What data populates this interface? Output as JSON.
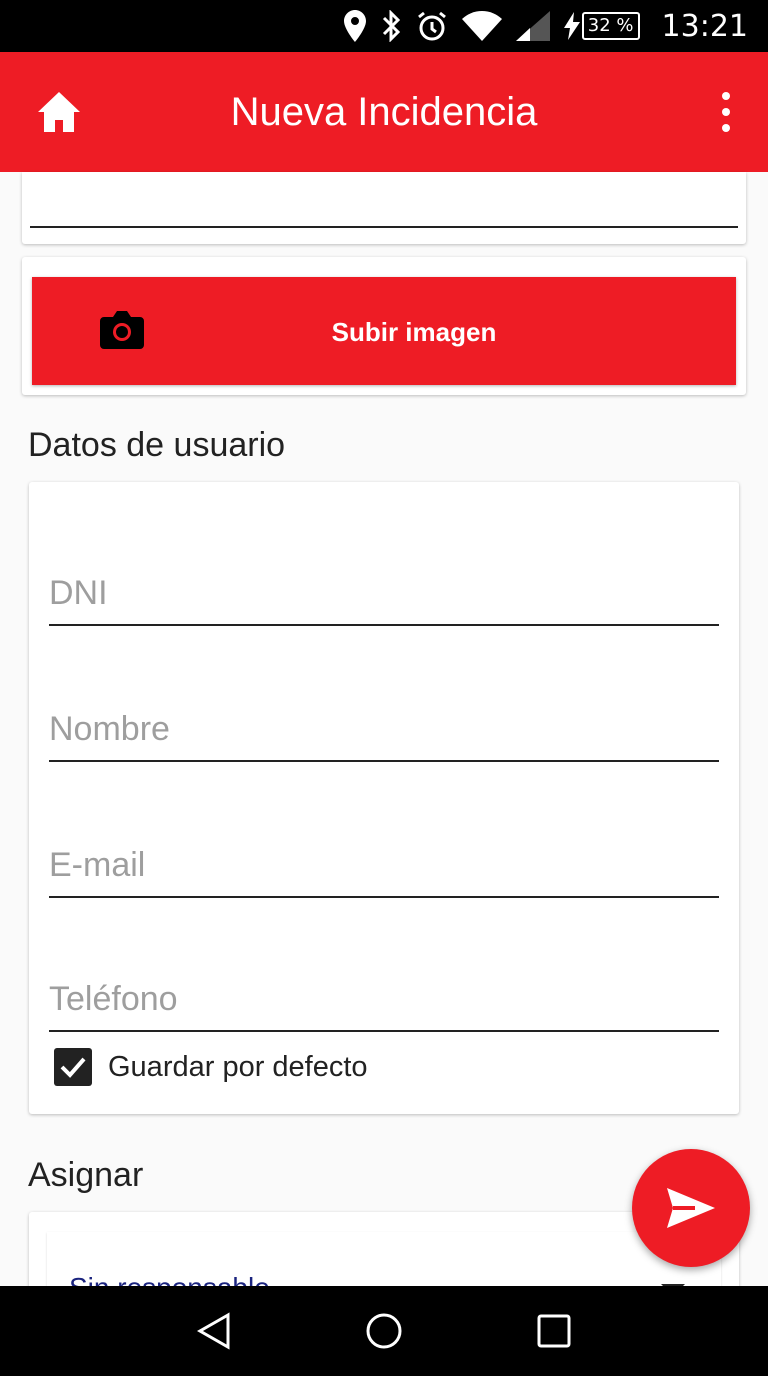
{
  "status_bar": {
    "time": "13:21",
    "battery": "32 %"
  },
  "app_bar": {
    "title": "Nueva Incidencia"
  },
  "upload": {
    "label": "Subir imagen"
  },
  "user_section": {
    "title": "Datos de usuario",
    "fields": [
      {
        "placeholder": "DNI",
        "value": ""
      },
      {
        "placeholder": "Nombre",
        "value": ""
      },
      {
        "placeholder": "E-mail",
        "value": ""
      },
      {
        "placeholder": "Teléfono",
        "value": ""
      }
    ],
    "save_default": {
      "label": "Guardar por defecto",
      "checked": true
    }
  },
  "assign_section": {
    "title": "Asignar",
    "selected": "Sin responsable"
  },
  "colors": {
    "accent": "#ee1c25",
    "status_bar": "#000000",
    "text": "#222222"
  }
}
